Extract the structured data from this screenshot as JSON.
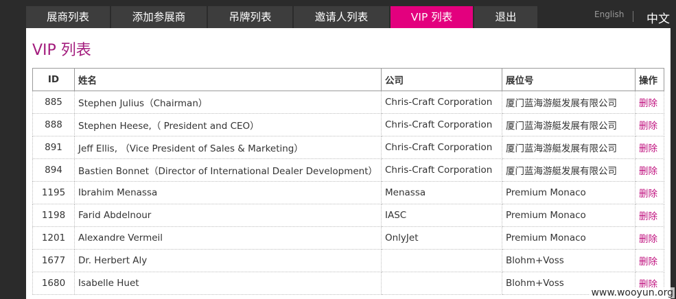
{
  "nav": {
    "items": [
      {
        "label": "展商列表",
        "active": false
      },
      {
        "label": "添加参展商",
        "active": false
      },
      {
        "label": "吊牌列表",
        "active": false
      },
      {
        "label": "邀请人列表",
        "active": false
      },
      {
        "label": "VIP 列表",
        "active": true
      },
      {
        "label": "退出",
        "active": false
      }
    ],
    "active_color": "#e3007e"
  },
  "language": {
    "english": "English",
    "chinese": "中文"
  },
  "page_title": "VIP 列表",
  "table": {
    "headers": {
      "id": "ID",
      "name": "姓名",
      "company": "公司",
      "booth": "展位号",
      "action": "操作"
    },
    "rows": [
      {
        "id": "885",
        "name": "Stephen Julius（Chairman）",
        "company": "Chris-Craft Corporation",
        "booth": "厦门蓝海游艇发展有限公司",
        "action": "删除"
      },
      {
        "id": "888",
        "name": "Stephen Heese,（ President and CEO）",
        "company": "Chris-Craft Corporation",
        "booth": "厦门蓝海游艇发展有限公司",
        "action": "删除"
      },
      {
        "id": "891",
        "name": "Jeff Ellis, （Vice President of Sales & Marketing）",
        "company": "Chris-Craft Corporation",
        "booth": "厦门蓝海游艇发展有限公司",
        "action": "删除"
      },
      {
        "id": "894",
        "name": "Bastien Bonnet（Director of International Dealer Development）",
        "company": "Chris-Craft Corporation",
        "booth": "厦门蓝海游艇发展有限公司",
        "action": "删除"
      },
      {
        "id": "1195",
        "name": "Ibrahim Menassa",
        "company": "Menassa",
        "booth": "Premium Monaco",
        "action": "删除"
      },
      {
        "id": "1198",
        "name": "Farid Abdelnour",
        "company": "IASC",
        "booth": "Premium Monaco",
        "action": "删除"
      },
      {
        "id": "1201",
        "name": "Alexandre Vermeil",
        "company": "OnlyJet",
        "booth": "Premium Monaco",
        "action": "删除"
      },
      {
        "id": "1677",
        "name": "Dr. Herbert Aly",
        "company": "",
        "booth": "Blohm+Voss",
        "action": "删除"
      },
      {
        "id": "1680",
        "name": "Isabelle Huet",
        "company": "",
        "booth": "Blohm+Voss",
        "action": "删除"
      }
    ]
  },
  "watermark": "www.wooyun.org"
}
